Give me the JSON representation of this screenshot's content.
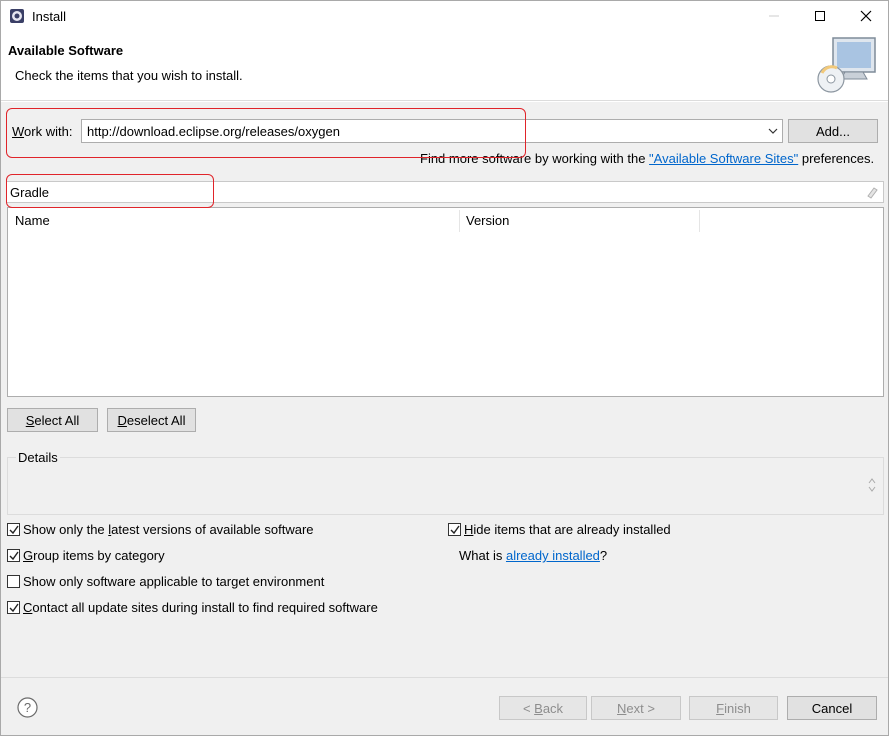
{
  "window": {
    "title": "Install"
  },
  "header": {
    "title": "Available Software",
    "description": "Check the items that you wish to install."
  },
  "work_with": {
    "label_prefix": "W",
    "label_rest": "ork with:",
    "value": "http://download.eclipse.org/releases/oxygen",
    "add_button": "Add..."
  },
  "find_more": {
    "prefix": "Find more software by working with the ",
    "link": "\"Available Software Sites\"",
    "suffix": " preferences."
  },
  "filter": {
    "value": "Gradle"
  },
  "table": {
    "columns": [
      "Name",
      "Version"
    ]
  },
  "selection_buttons": {
    "select_all_prefix": "S",
    "select_all_rest": "elect All",
    "deselect_all_prefix": "D",
    "deselect_all_rest": "eselect All"
  },
  "details": {
    "label": "Details"
  },
  "options": {
    "show_latest": {
      "a": "Show only the ",
      "u": "l",
      "b": "atest versions of available software",
      "checked": true
    },
    "group_by_category": {
      "a": "",
      "u": "G",
      "b": "roup items by category",
      "checked": true
    },
    "show_applicable": {
      "a": "Show only software applicable to target environment",
      "u": "",
      "b": "",
      "checked": false
    },
    "contact_sites": {
      "a": "",
      "u": "C",
      "b": "ontact all update sites during install to find required software",
      "checked": true
    },
    "hide_installed": {
      "a": "",
      "u": "H",
      "b": "ide items that are already installed",
      "checked": true
    },
    "what_is": {
      "prefix": "What is ",
      "link": "already installed",
      "suffix": "?"
    }
  },
  "footer": {
    "back_prefix": "< ",
    "back_u": "B",
    "back_rest": "ack",
    "next_u": "N",
    "next_rest": "ext >",
    "finish_u": "F",
    "finish_rest": "inish",
    "cancel": "Cancel"
  },
  "colors": {
    "highlight_box": "#e0242a",
    "link": "#0066cc",
    "dialog_bg": "#f0f0f0"
  }
}
